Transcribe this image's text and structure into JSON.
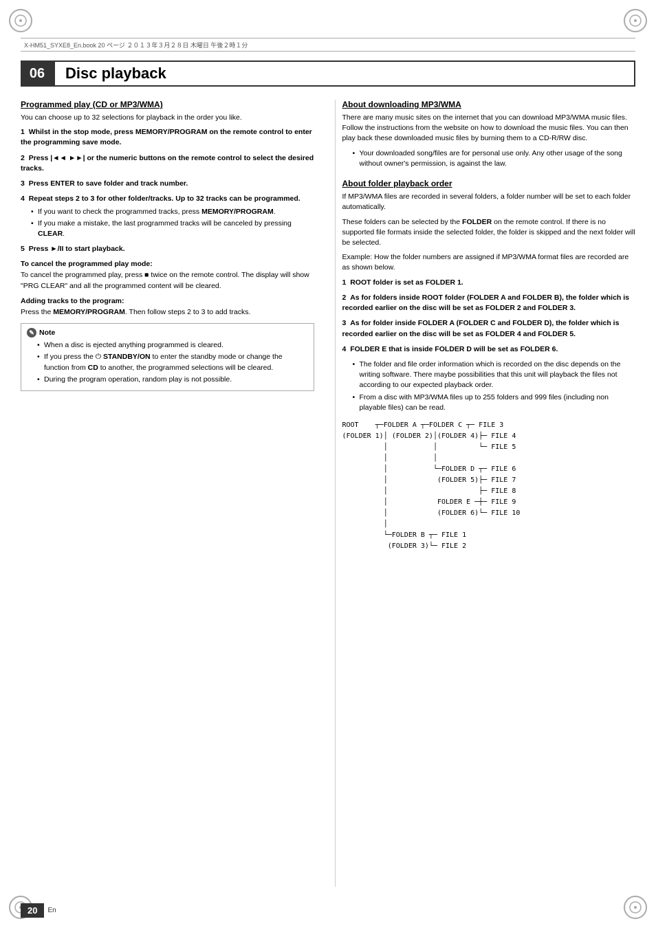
{
  "header": {
    "file_info": "X-HM51_SYXE8_En.book   20 ページ   ２０１３年３月２８日   木曜日   午後２時１分"
  },
  "chapter": {
    "number": "06",
    "title": "Disc playback"
  },
  "left_column": {
    "section1": {
      "heading": "Programmed play (CD or MP3/WMA)",
      "intro": "You can choose up to 32 selections for playback in the order you like.",
      "steps": [
        {
          "num": "1",
          "text": "Whilst in the stop mode, press MEMORY/PROGRAM on the remote control to enter the programming save mode."
        },
        {
          "num": "2",
          "text": "Press |◄◄ ►►| or the numeric buttons on the remote control to select the desired tracks."
        },
        {
          "num": "3",
          "text": "Press ENTER to save folder and track number."
        },
        {
          "num": "4",
          "text": "Repeat steps 2 to 3 for other folder/tracks. Up to 32 tracks can be programmed.",
          "bullets": [
            "If you want to check the programmed tracks, press MEMORY/PROGRAM.",
            "If you make a mistake, the last programmed tracks will be canceled by pressing CLEAR."
          ]
        },
        {
          "num": "5",
          "text": "Press ►/II to start playback."
        }
      ],
      "cancel_heading": "To cancel the programmed play mode:",
      "cancel_text": "To cancel the programmed play, press ■ twice on the remote control. The display will show \"PRG CLEAR\" and all the programmed content will be cleared.",
      "adding_heading": "Adding tracks to the program:",
      "adding_text": "Press the MEMORY/PROGRAM. Then follow steps 2 to 3 to add tracks.",
      "note": {
        "title": "Note",
        "bullets": [
          "When a disc is ejected anything programmed is cleared.",
          "If you press the ⏻ STANDBY/ON to enter the standby mode or change the function from CD to another, the programmed selections will be cleared.",
          "During the program operation, random play is not possible."
        ]
      }
    }
  },
  "right_column": {
    "section1": {
      "heading": "About downloading MP3/WMA",
      "text1": "There are many music sites on the internet that you can download MP3/WMA music files. Follow the instructions from the website on how to download the music files. You can then play back these downloaded music files by burning them to a CD-R/RW disc.",
      "bullets": [
        "Your downloaded song/files are for personal use only. Any other usage of the song without owner's permission, is against the law."
      ]
    },
    "section2": {
      "heading": "About folder playback order",
      "text1": "If MP3/WMA files are recorded in several folders, a folder number will be set to each folder automatically.",
      "text2": "These folders can be selected by the FOLDER on the remote control. If there is no supported file formats inside the selected folder, the folder is skipped and the next folder will be selected.",
      "text3": "Example: How the folder numbers are assigned if MP3/WMA format files are recorded are as shown below.",
      "steps": [
        {
          "num": "1",
          "text": "ROOT folder is set as FOLDER 1."
        },
        {
          "num": "2",
          "text": "As for folders inside ROOT folder (FOLDER A and FOLDER B), the folder which is recorded earlier on the disc will be set as FOLDER 2 and FOLDER 3."
        },
        {
          "num": "3",
          "text": "As for folder inside FOLDER A (FOLDER C and FOLDER D), the folder which is recorded earlier on the disc will be set as FOLDER 4 and FOLDER 5."
        },
        {
          "num": "4",
          "text": "FOLDER E that is inside FOLDER D will be set as FOLDER 6."
        }
      ],
      "bullets": [
        "The folder and file order information which is recorded on the disc depends on the writing software. There maybe possibilities that this unit will playback the files not according to our expected playback order.",
        "From a disc with MP3/WMA files up to 255 folders and 999 files (including non playable files) can be read."
      ],
      "tree_label": "Folder tree diagram"
    }
  },
  "footer": {
    "page_number": "20",
    "language": "En"
  }
}
